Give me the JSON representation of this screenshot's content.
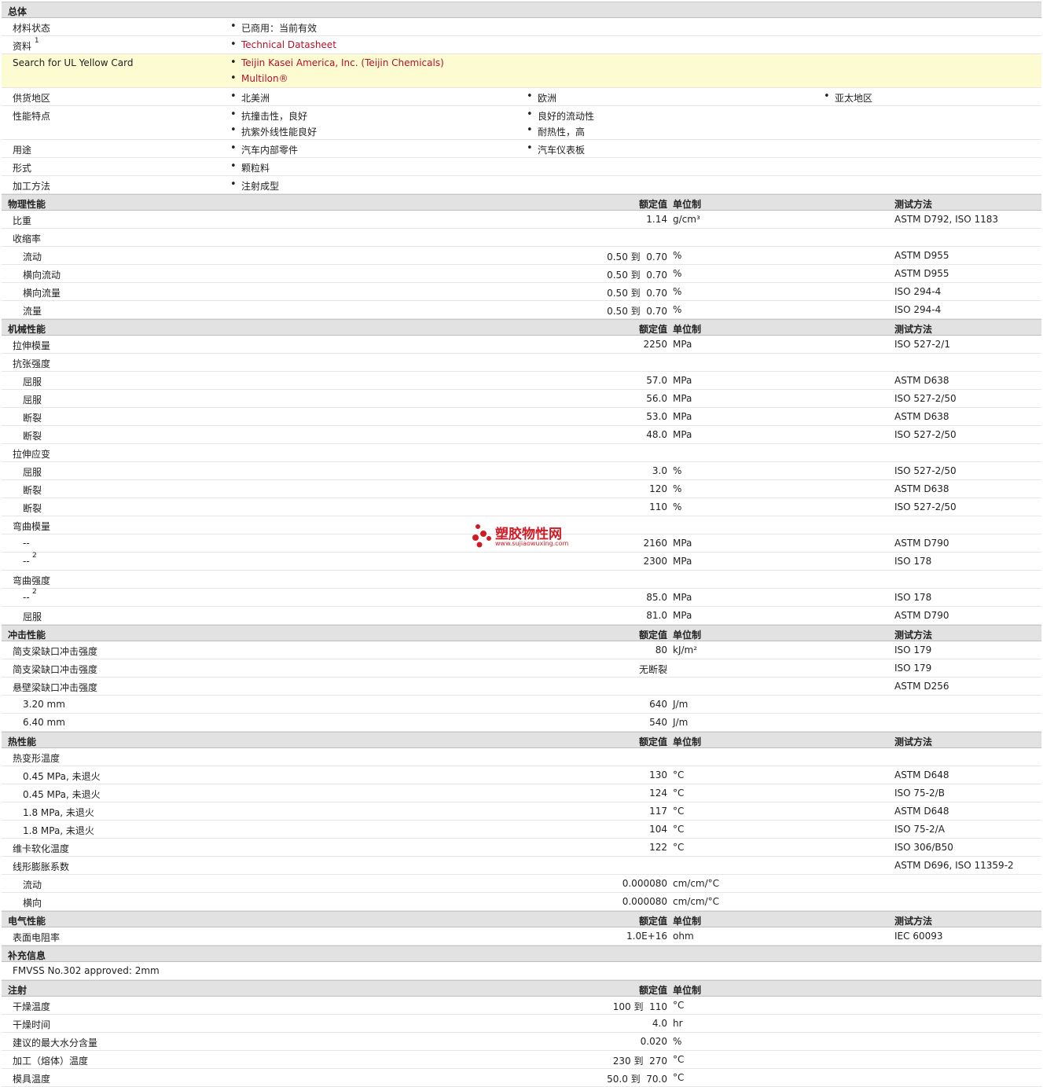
{
  "general": {
    "header": "总体",
    "status_label": "材料状态",
    "status_value": "已商用：当前有效",
    "docs_label": "资料",
    "docs_sup": "1",
    "docs_link": "Technical Datasheet",
    "ul_label": "Search for UL Yellow Card",
    "ul_link1": "Teijin Kasei America, Inc. (Teijin Chemicals)",
    "ul_link2": "Multilon®",
    "region_label": "供货地区",
    "region1": "北美洲",
    "region2": "欧洲",
    "region3": "亚太地区",
    "features_label": "性能特点",
    "feat1": "抗撞击性，良好",
    "feat2": "良好的流动性",
    "feat3": "抗紫外线性能良好",
    "feat4": "耐热性，高",
    "uses_label": "用途",
    "use1": "汽车内部零件",
    "use2": "汽车仪表板",
    "form_label": "形式",
    "form1": "颗粒料",
    "process_label": "加工方法",
    "process1": "注射成型"
  },
  "headers": {
    "nominal": "额定值",
    "unit": "单位制",
    "method": "测试方法"
  },
  "sections": {
    "physical": "物理性能",
    "mechanical": "机械性能",
    "impact": "冲击性能",
    "thermal": "热性能",
    "electrical": "电气性能",
    "supplement": "补充信息",
    "injection": "注射"
  },
  "physical": [
    {
      "label": "比重",
      "value": "1.14",
      "unit": "g/cm³",
      "method": "ASTM D792, ISO 1183"
    },
    {
      "label": "收缩率"
    },
    {
      "label": "流动",
      "value": "0.50 到  0.70",
      "unit": "%",
      "method": "ASTM D955"
    },
    {
      "label": "横向流动",
      "value": "0.50 到  0.70",
      "unit": "%",
      "method": "ASTM D955"
    },
    {
      "label": "横向流量",
      "value": "0.50 到  0.70",
      "unit": "%",
      "method": "ISO 294-4"
    },
    {
      "label": "流量",
      "value": "0.50 到  0.70",
      "unit": "%",
      "method": "ISO 294-4"
    }
  ],
  "mechanical": [
    {
      "label": "拉伸模量",
      "value": "2250",
      "unit": "MPa",
      "method": "ISO 527-2/1"
    },
    {
      "label": "抗张强度"
    },
    {
      "label": "屈服",
      "value": "57.0",
      "unit": "MPa",
      "method": "ASTM D638"
    },
    {
      "label": "屈服",
      "value": "56.0",
      "unit": "MPa",
      "method": "ISO 527-2/50"
    },
    {
      "label": "断裂",
      "value": "53.0",
      "unit": "MPa",
      "method": "ASTM D638"
    },
    {
      "label": "断裂",
      "value": "48.0",
      "unit": "MPa",
      "method": "ISO 527-2/50"
    },
    {
      "label": "拉伸应变"
    },
    {
      "label": "屈服",
      "value": "3.0",
      "unit": "%",
      "method": "ISO 527-2/50"
    },
    {
      "label": "断裂",
      "value": "120",
      "unit": "%",
      "method": "ASTM D638"
    },
    {
      "label": "断裂",
      "value": "110",
      "unit": "%",
      "method": "ISO 527-2/50"
    },
    {
      "label": "弯曲模量"
    },
    {
      "label": "--",
      "value": "2160",
      "unit": "MPa",
      "method": "ASTM D790"
    },
    {
      "label": "--",
      "sup": "2",
      "value": "2300",
      "unit": "MPa",
      "method": "ISO 178"
    },
    {
      "label": "弯曲强度"
    },
    {
      "label": "--",
      "sup": "2",
      "value": "85.0",
      "unit": "MPa",
      "method": "ISO 178"
    },
    {
      "label": "屈服",
      "value": "81.0",
      "unit": "MPa",
      "method": "ASTM D790"
    }
  ],
  "impact": [
    {
      "label": "简支梁缺口冲击强度",
      "value": "80",
      "unit": "kJ/m²",
      "method": "ISO 179"
    },
    {
      "label": "简支梁缺口冲击强度",
      "value": "无断裂",
      "unit": "",
      "method": "ISO 179"
    },
    {
      "label": "悬壁梁缺口冲击强度",
      "method": "ASTM D256"
    },
    {
      "label": "3.20 mm",
      "value": "640",
      "unit": "J/m"
    },
    {
      "label": "6.40 mm",
      "value": "540",
      "unit": "J/m"
    }
  ],
  "thermal": [
    {
      "label": "热变形温度"
    },
    {
      "label": "0.45 MPa, 未退火",
      "value": "130",
      "unit": "°C",
      "method": "ASTM D648"
    },
    {
      "label": "0.45 MPa, 未退火",
      "value": "124",
      "unit": "°C",
      "method": "ISO 75-2/B"
    },
    {
      "label": "1.8 MPa, 未退火",
      "value": "117",
      "unit": "°C",
      "method": "ASTM D648"
    },
    {
      "label": "1.8 MPa, 未退火",
      "value": "104",
      "unit": "°C",
      "method": "ISO 75-2/A"
    },
    {
      "label": "维卡软化温度",
      "value": "122",
      "unit": "°C",
      "method": "ISO 306/B50"
    },
    {
      "label": "线形膨胀系数",
      "method": "ASTM D696, ISO 11359-2"
    },
    {
      "label": "流动",
      "value": "0.000080",
      "unit": "cm/cm/°C"
    },
    {
      "label": "横向",
      "value": "0.000080",
      "unit": "cm/cm/°C"
    }
  ],
  "electrical": [
    {
      "label": "表面电阻率",
      "value": "1.0E+16",
      "unit": "ohm",
      "method": "IEC 60093"
    }
  ],
  "supplement_text": "FMVSS No.302 approved: 2mm",
  "injection": [
    {
      "label": "干燥温度",
      "value": "100 到  110",
      "unit": "°C"
    },
    {
      "label": "干燥时间",
      "value": "4.0",
      "unit": "hr"
    },
    {
      "label": "建议的最大水分含量",
      "value": "0.020",
      "unit": "%"
    },
    {
      "label": "加工（熔体）温度",
      "value": "230 到  270",
      "unit": "°C"
    },
    {
      "label": "模具温度",
      "value": "50.0 到  70.0",
      "unit": "°C"
    }
  ],
  "watermark": {
    "title": "塑胶物性网",
    "url": "www.sujiaowuxing.com",
    "color": "#d21a24"
  }
}
